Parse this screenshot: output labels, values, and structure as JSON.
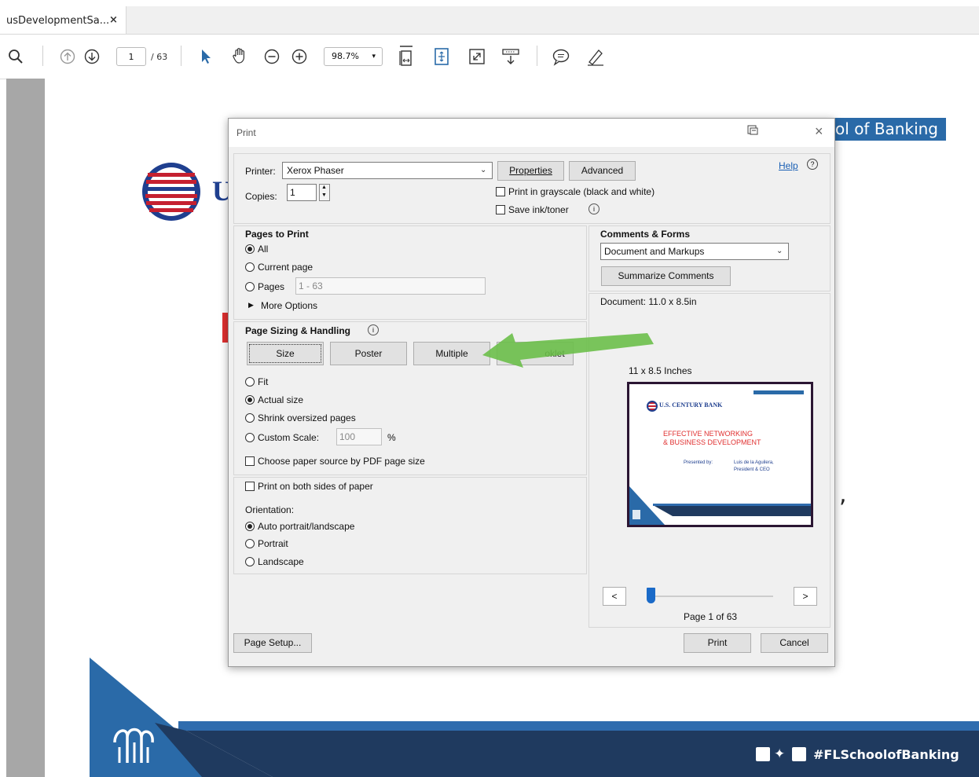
{
  "tab": {
    "title": "usDevelopmentSa...",
    "close": "×"
  },
  "toolbar": {
    "current_page": "1",
    "total_pages": "/ 63",
    "zoom": "98.7%",
    "zoom_caret": "▾"
  },
  "document": {
    "banner_text": "ool of Banking",
    "footer_hashtag": "#FLSchoolofBanking",
    "brand_letter": "U",
    "side_comma": ","
  },
  "colors": {
    "accent_blue": "#2a6aa8",
    "arrow_green": "#6cbf4a",
    "footer_navy": "#1f3a5f",
    "preview_red": "#e03030"
  },
  "dialog": {
    "title": "Print",
    "close": "×",
    "printer_label": "Printer:",
    "printer_value": "Xerox Phaser",
    "properties_button": "Properties",
    "advanced_button": "Advanced",
    "help_link": "Help",
    "copies_label": "Copies:",
    "copies_value": "1",
    "grayscale_label": "Print in grayscale (black and white)",
    "save_ink_label": "Save ink/toner",
    "pages_to_print": {
      "heading": "Pages to Print",
      "all": "All",
      "current_page": "Current page",
      "pages": "Pages",
      "pages_value": "1 - 63",
      "more_options": "More Options"
    },
    "sizing": {
      "heading": "Page Sizing & Handling",
      "tabs": [
        "Size",
        "Poster",
        "Multiple",
        "oklet"
      ],
      "fit": "Fit",
      "actual_size": "Actual size",
      "shrink": "Shrink oversized pages",
      "custom_scale": "Custom Scale:",
      "scale_value": "100",
      "percent": "%",
      "paper_source": "Choose paper source by PDF page size"
    },
    "orientation": {
      "both_sides": "Print on both sides of paper",
      "heading": "Orientation:",
      "auto": "Auto portrait/landscape",
      "portrait": "Portrait",
      "landscape": "Landscape"
    },
    "comments": {
      "heading": "Comments & Forms",
      "value": "Document and Markups",
      "summarize_button": "Summarize Comments"
    },
    "preview": {
      "document_size": "Document: 11.0 x 8.5in",
      "paper_size": "11 x 8.5 Inches",
      "bank_name": "U.S. CENTURY BANK",
      "headline_1": "EFFECTIVE NETWORKING",
      "headline_2": "& BUSINESS DEVELOPMENT",
      "presented_by": "Presented by:",
      "presenter_name": "Luis de la Aguilera,",
      "presenter_title": "President & CEO",
      "prev": "<",
      "next": ">",
      "page_indicator": "Page 1 of 63",
      "slider_position": 0
    },
    "page_setup_button": "Page Setup...",
    "print_button": "Print",
    "cancel_button": "Cancel"
  }
}
